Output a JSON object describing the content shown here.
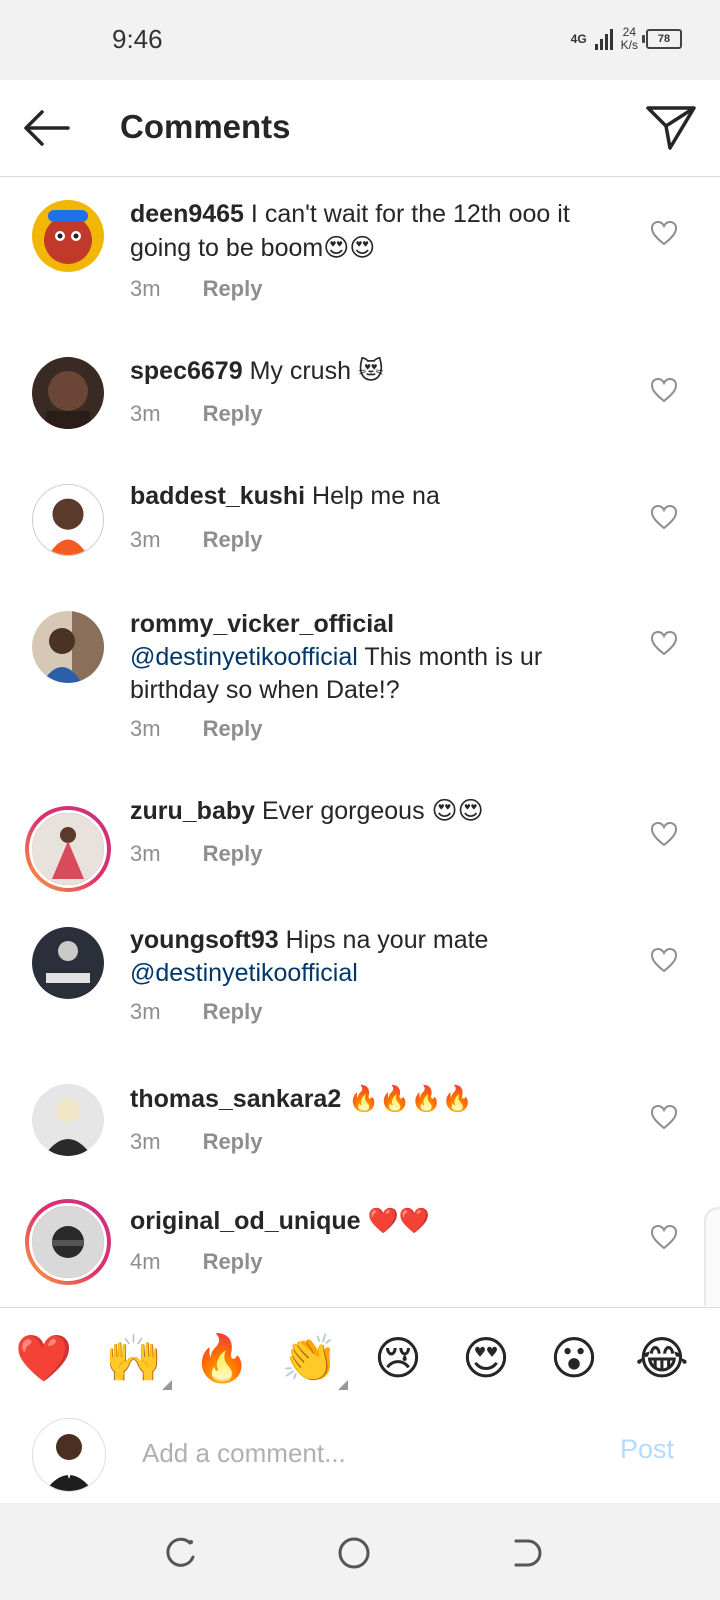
{
  "status_bar": {
    "time": "9:46",
    "network": "4G",
    "speed_value": "24",
    "speed_unit": "K/s",
    "battery": "78"
  },
  "header": {
    "title": "Comments",
    "back_icon": "arrow-left-icon",
    "send_icon": "paper-plane-icon"
  },
  "comments": [
    {
      "username": "deen9465",
      "text": "I can't wait for the 12th ooo it going to be boom",
      "emoji": "😍😍",
      "time": "3m",
      "reply": "Reply"
    },
    {
      "username": "spec6679",
      "text": "My crush",
      "emoji": "😻",
      "time": "3m",
      "reply": "Reply"
    },
    {
      "username": "baddest_kushi",
      "text": "Help me na",
      "time": "3m",
      "reply": "Reply"
    },
    {
      "username": "rommy_vicker_official",
      "mention": "@destinyetikoofficial",
      "text": "This month is ur birthday so when Date!?",
      "time": "3m",
      "reply": "Reply"
    },
    {
      "username": "zuru_baby",
      "text": "Ever gorgeous",
      "emoji": "😍😍",
      "time": "3m",
      "reply": "Reply"
    },
    {
      "username": "youngsoft93",
      "text": "Hips na your mate",
      "mention": "@destinyetikoofficial",
      "time": "3m",
      "reply": "Reply"
    },
    {
      "username": "thomas_sankara2",
      "emoji": "🔥🔥🔥🔥",
      "time": "3m",
      "reply": "Reply"
    },
    {
      "username": "original_od_unique",
      "emoji": "❤️❤️",
      "time": "4m",
      "reply": "Reply"
    }
  ],
  "reactions": [
    "❤️",
    "🙌",
    "🔥",
    "👏",
    "😢",
    "😍",
    "😮",
    "😂"
  ],
  "composer": {
    "placeholder": "Add a comment...",
    "post_label": "Post"
  },
  "colors": {
    "text": "#262626",
    "secondary": "#8e8e8e",
    "mention": "#00376b",
    "post_disabled": "#b3dbff"
  }
}
